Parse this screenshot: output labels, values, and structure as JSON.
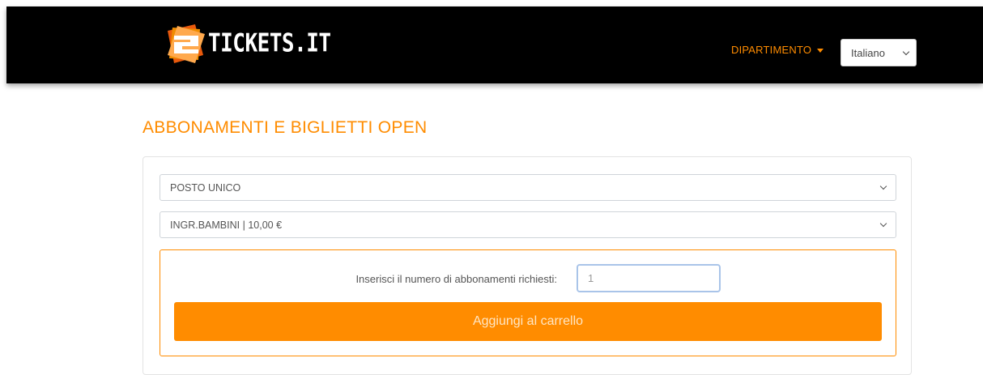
{
  "brand": {
    "logo_text": "TICKETS.IT"
  },
  "header": {
    "department_label": "DIPARTIMENTO",
    "language": {
      "selected": "Italiano"
    }
  },
  "main": {
    "title": "ABBONAMENTI E BIGLIETTI OPEN",
    "sector_select": {
      "selected": "POSTO UNICO"
    },
    "price_select": {
      "selected": "INGR.BAMBINI | 10,00 €"
    },
    "quantity": {
      "label": "Inserisci il numero di abbonamenti richiesti:",
      "value": "1"
    },
    "add_to_cart_label": "Aggiungi al carrello"
  },
  "colors": {
    "accent": "#ff8c00",
    "navbar": "#000000"
  }
}
